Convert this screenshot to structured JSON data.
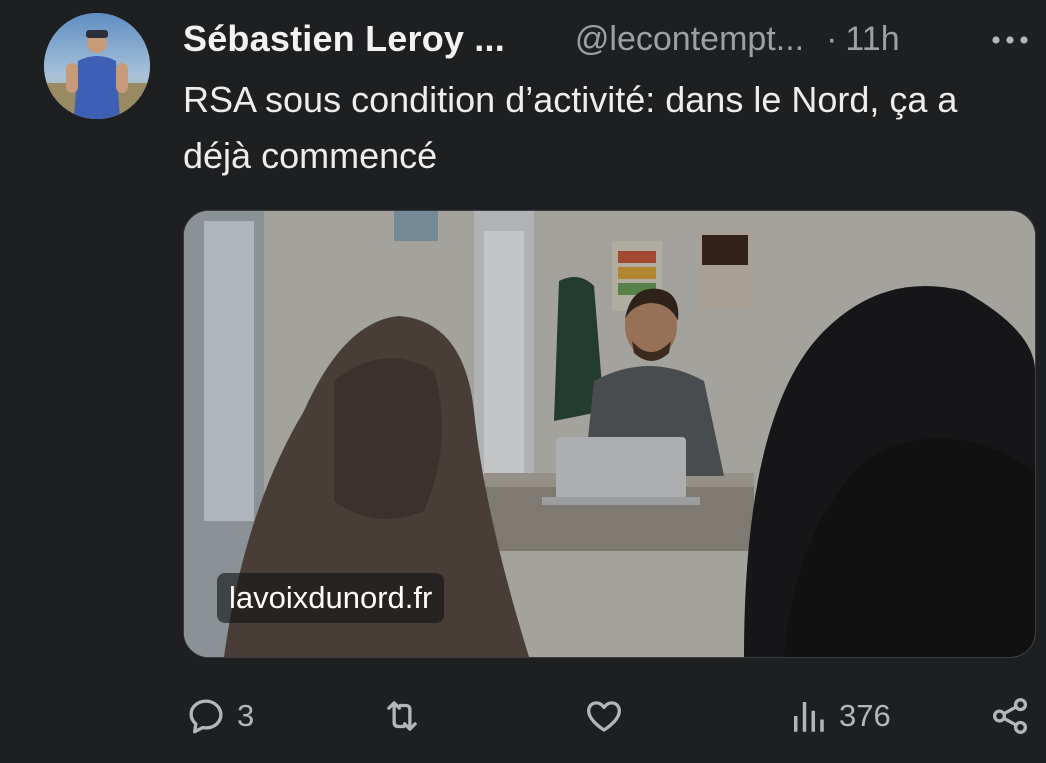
{
  "tweet": {
    "author_name": "Sébastien Leroy ...",
    "handle": "@lecontempt...",
    "separator": "·",
    "time": "11h",
    "text": "RSA sous condition d’activité: dans le Nord, ça a déjà commencé"
  },
  "link_card": {
    "domain": "lavoixdunord.fr"
  },
  "actions": {
    "reply_count": "3",
    "views_count": "376"
  },
  "icons": {
    "more": "more-horizontal-icon",
    "reply": "reply-icon",
    "retweet": "retweet-icon",
    "like": "heart-icon",
    "views": "views-icon",
    "share": "share-icon"
  },
  "colors": {
    "background": "#1e1f21",
    "text_primary": "#ededed",
    "text_secondary": "#9aa0a6"
  }
}
